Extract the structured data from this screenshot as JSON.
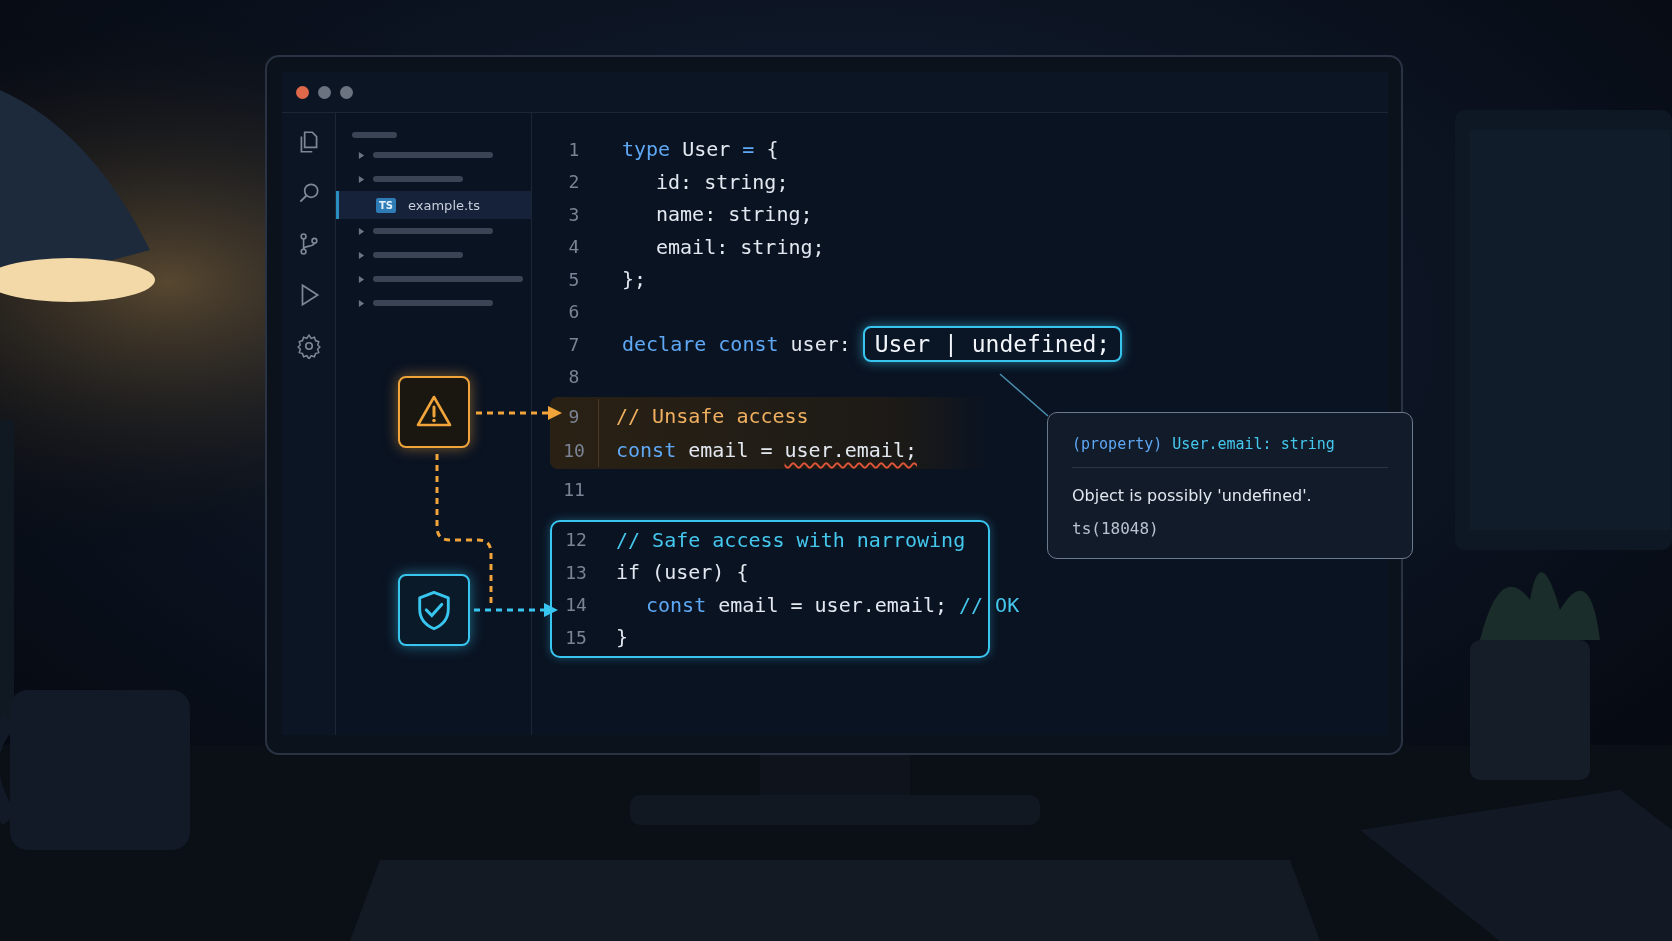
{
  "window": {
    "controls": [
      {
        "color": "#e0684a"
      },
      {
        "color": "#6b7280"
      },
      {
        "color": "#6b7280"
      }
    ]
  },
  "explorer": {
    "items": [
      {
        "kind": "heading"
      },
      {
        "kind": "folder"
      },
      {
        "kind": "folder"
      },
      {
        "kind": "file",
        "badge": "TS",
        "label": "example.ts",
        "selected": true
      },
      {
        "kind": "folder"
      },
      {
        "kind": "folder"
      },
      {
        "kind": "folder"
      },
      {
        "kind": "folder"
      }
    ]
  },
  "code": {
    "blocks": [
      {
        "kind": "plain",
        "lines": [
          {
            "number": "1",
            "tokens": [
              {
                "kind": "keyword",
                "text": "type"
              },
              {
                "kind": "plain",
                "text": "User"
              },
              {
                "kind": "keyword",
                "text": "="
              },
              {
                "kind": "plain",
                "text": "{"
              }
            ]
          },
          {
            "number": "2",
            "indented": true,
            "tokens": [
              {
                "kind": "plain",
                "text": "id: string;"
              }
            ]
          },
          {
            "number": "3",
            "indented": true,
            "tokens": [
              {
                "kind": "plain",
                "text": "name: string;"
              }
            ]
          },
          {
            "number": "4",
            "indented": true,
            "tokens": [
              {
                "kind": "plain",
                "text": "email: string;"
              }
            ]
          },
          {
            "number": "5",
            "tokens": [
              {
                "kind": "plain",
                "text": "};"
              }
            ]
          },
          {
            "number": "6"
          },
          {
            "number": "7",
            "tokens": [
              {
                "kind": "keyword",
                "text": "declare const"
              },
              {
                "kind": "plain",
                "text": "user:"
              },
              {
                "kind": "highlight",
                "text": "User | undefined;"
              }
            ]
          },
          {
            "number": "8"
          }
        ]
      },
      {
        "kind": "warning",
        "lines": [
          {
            "number": "9",
            "tokens": [
              {
                "kind": "comment",
                "text": "// Unsafe access"
              }
            ]
          },
          {
            "number": "10",
            "tokens": [
              {
                "kind": "keyword",
                "text": "const"
              },
              {
                "kind": "plain",
                "text": "email ="
              },
              {
                "kind": "error",
                "text": "user.email;"
              }
            ]
          }
        ]
      },
      {
        "kind": "plain",
        "lines": [
          {
            "number": "11"
          }
        ]
      },
      {
        "kind": "safe",
        "lines": [
          {
            "number": "12",
            "tokens": [
              {
                "kind": "comment",
                "text": "// Safe access with narrowing"
              }
            ]
          },
          {
            "number": "13",
            "tokens": [
              {
                "kind": "plain",
                "text": "if (user) {"
              }
            ]
          },
          {
            "number": "14",
            "indented": true,
            "tokens": [
              {
                "kind": "keyword",
                "text": "const"
              },
              {
                "kind": "plain",
                "text": "email = user.email;"
              },
              {
                "kind": "comment",
                "text": "// OK"
              }
            ]
          },
          {
            "number": "15",
            "tokens": [
              {
                "kind": "plain",
                "text": "}"
              }
            ]
          }
        ]
      }
    ]
  },
  "tooltip": {
    "kind_label": "(property)",
    "signature": "User.email: string",
    "message": "Object is possibly 'undefined'.",
    "code": "ts(18048)"
  }
}
